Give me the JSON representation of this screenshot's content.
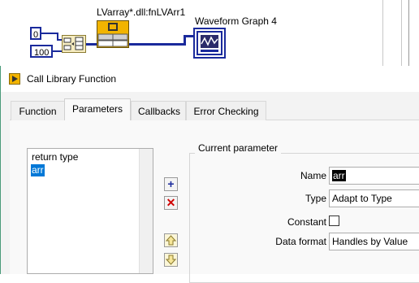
{
  "diagram": {
    "const_zero": "0",
    "const_hundred": "100",
    "dll_node_label": "LVarray*.dll:fnLVArr1",
    "graph_label": "Waveform Graph 4"
  },
  "dialog": {
    "title": "Call Library Function",
    "tabs": [
      {
        "label": "Function"
      },
      {
        "label": "Parameters"
      },
      {
        "label": "Callbacks"
      },
      {
        "label": "Error Checking"
      }
    ],
    "parameters_list": [
      "return type",
      "arr"
    ],
    "selected_parameter": "arr",
    "current_parameter": {
      "group_title": "Current parameter",
      "name_label": "Name",
      "name_value": "arr",
      "type_label": "Type",
      "type_value": "Adapt to Type",
      "constant_label": "Constant",
      "constant_checked": false,
      "data_format_label": "Data format",
      "data_format_value": "Handles by Value"
    },
    "colors": {
      "wire": "#1a2a9c",
      "dll_node": "#f2b400",
      "selection": "#0078d7",
      "dialog_border": "#4a9a7a"
    }
  }
}
